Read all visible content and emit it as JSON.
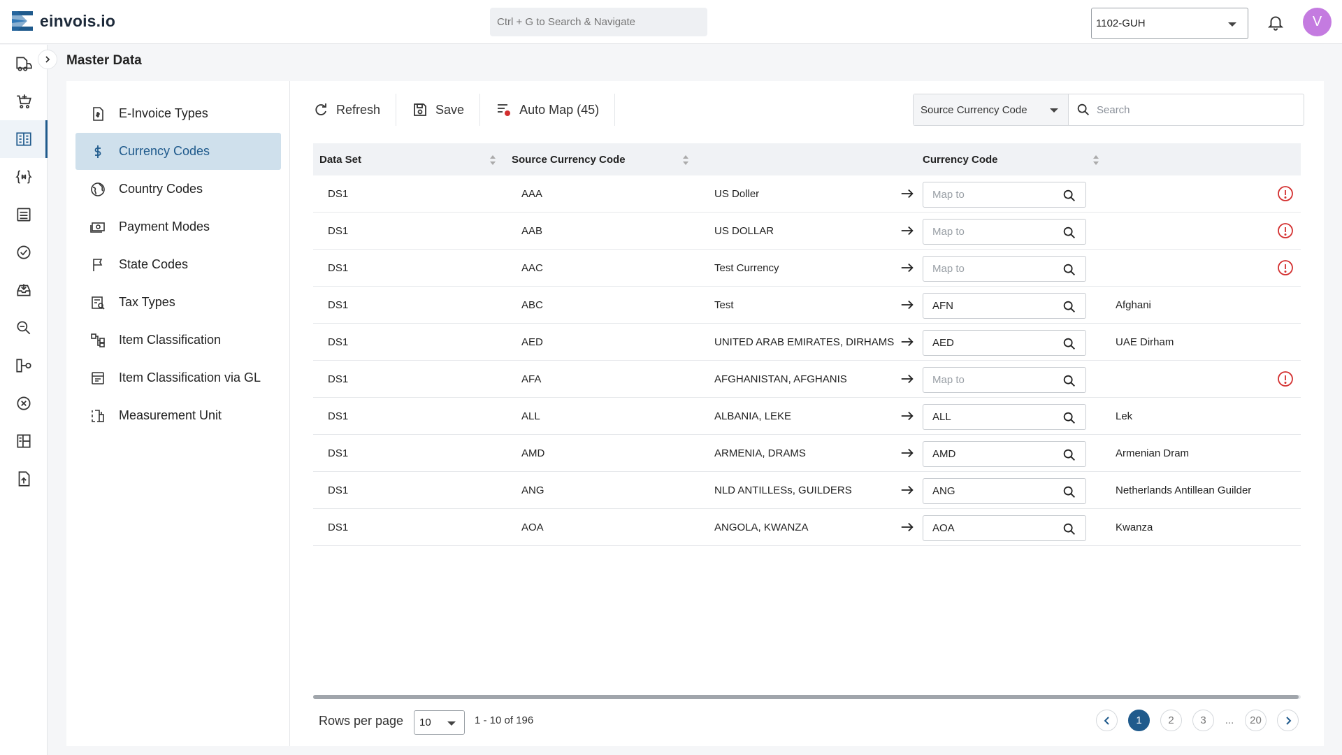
{
  "app": {
    "name": "einvois.io"
  },
  "header": {
    "search_placeholder": "Ctrl + G to Search & Navigate",
    "company": "1102-GUH",
    "avatar_initial": "V"
  },
  "page": {
    "title": "Master Data"
  },
  "rail": [
    "truck-icon",
    "cart-icon",
    "master-data-icon",
    "variables-icon",
    "document-list-icon",
    "check-circle-icon",
    "inbox-icon",
    "search-doc-icon",
    "flow-icon",
    "cancel-circle-icon",
    "dashboard-icon",
    "upload-doc-icon"
  ],
  "subnav": {
    "items": [
      {
        "label": "E-Invoice Types",
        "icon": "invoice-icon"
      },
      {
        "label": "Currency Codes",
        "icon": "dollar-icon"
      },
      {
        "label": "Country Codes",
        "icon": "globe-icon"
      },
      {
        "label": "Payment Modes",
        "icon": "cash-icon"
      },
      {
        "label": "State Codes",
        "icon": "flag-icon"
      },
      {
        "label": "Tax Types",
        "icon": "tax-icon"
      },
      {
        "label": "Item Classification",
        "icon": "tree-icon"
      },
      {
        "label": "Item Classification via GL",
        "icon": "ledger-icon"
      },
      {
        "label": "Measurement Unit",
        "icon": "unit-icon"
      }
    ],
    "active_index": 1
  },
  "toolbar": {
    "refresh_label": "Refresh",
    "save_label": "Save",
    "automap_label": "Auto Map (45)"
  },
  "filter": {
    "field": "Source Currency Code",
    "search_placeholder": "Search"
  },
  "table": {
    "columns": [
      "Data Set",
      "Source Currency Code",
      "Currency Code"
    ],
    "map_placeholder": "Map to",
    "rows": [
      {
        "dataset": "DS1",
        "code": "AAA",
        "desc": "US Doller",
        "mapped": "",
        "mapped_name": "",
        "warning": true
      },
      {
        "dataset": "DS1",
        "code": "AAB",
        "desc": "US DOLLAR",
        "mapped": "",
        "mapped_name": "",
        "warning": true
      },
      {
        "dataset": "DS1",
        "code": "AAC",
        "desc": "Test Currency",
        "mapped": "",
        "mapped_name": "",
        "warning": true
      },
      {
        "dataset": "DS1",
        "code": "ABC",
        "desc": "Test",
        "mapped": "AFN",
        "mapped_name": "Afghani",
        "warning": false
      },
      {
        "dataset": "DS1",
        "code": "AED",
        "desc": "UNITED ARAB EMIRATES, DIRHAMS",
        "mapped": "AED",
        "mapped_name": "UAE Dirham",
        "warning": false
      },
      {
        "dataset": "DS1",
        "code": "AFA",
        "desc": "AFGHANISTAN, AFGHANIS",
        "mapped": "",
        "mapped_name": "",
        "warning": true
      },
      {
        "dataset": "DS1",
        "code": "ALL",
        "desc": "ALBANIA, LEKE",
        "mapped": "ALL",
        "mapped_name": "Lek",
        "warning": false
      },
      {
        "dataset": "DS1",
        "code": "AMD",
        "desc": "ARMENIA, DRAMS",
        "mapped": "AMD",
        "mapped_name": "Armenian Dram",
        "warning": false
      },
      {
        "dataset": "DS1",
        "code": "ANG",
        "desc": "NLD ANTILLESs, GUILDERS",
        "mapped": "ANG",
        "mapped_name": "Netherlands Antillean Guilder",
        "warning": false
      },
      {
        "dataset": "DS1",
        "code": "AOA",
        "desc": "ANGOLA, KWANZA",
        "mapped": "AOA",
        "mapped_name": "Kwanza",
        "warning": false
      }
    ]
  },
  "pagination": {
    "rows_per_page_label": "Rows per page",
    "rows_per_page": "10",
    "range": "1 - 10 of 196",
    "pages": [
      "1",
      "2",
      "3"
    ],
    "ellipsis": "...",
    "last_page": "20",
    "current": "1"
  },
  "colors": {
    "accent": "#1f5a8c",
    "active_bg": "#cfe0ec",
    "warning": "#d32f2f",
    "avatar": "#c47be0"
  }
}
